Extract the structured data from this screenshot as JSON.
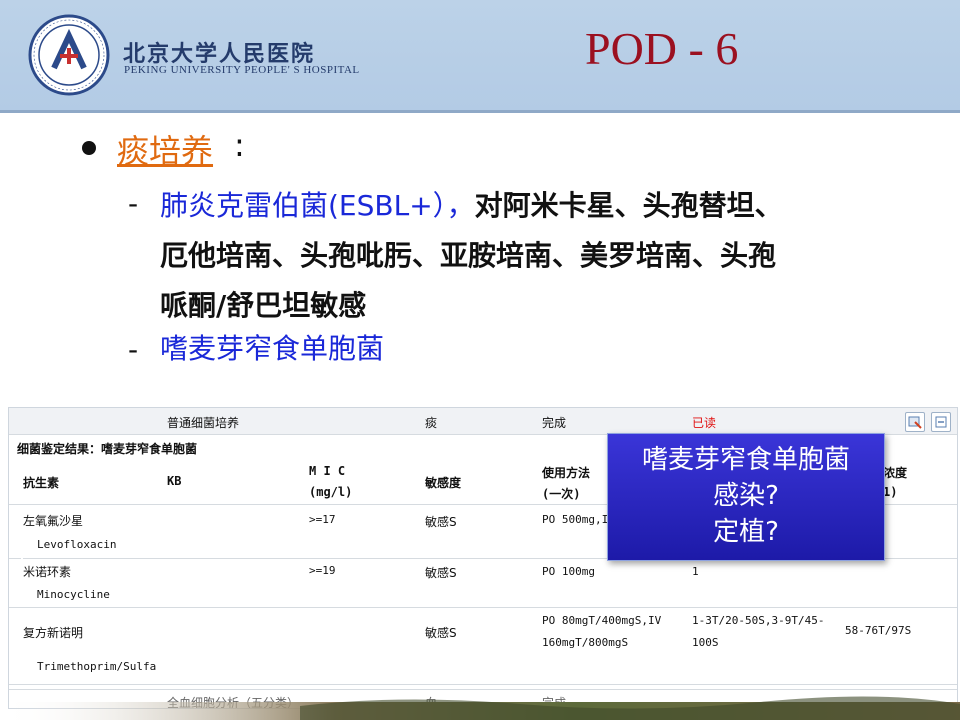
{
  "header": {
    "org_cn": "北京大学人民医院",
    "org_en": "PEKING UNIVERSITY PEOPLE' S HOSPITAL",
    "title": "POD - 6"
  },
  "content": {
    "bullet_title": "痰培养",
    "bullet_colon": ":",
    "item1_blue": "肺炎克雷伯菌(ESBL+），",
    "item1_black_a": "对阿米卡星、头孢替坦、",
    "item1_line2": "厄他培南、头孢吡肟、亚胺培南、美罗培南、头孢",
    "item1_line3": "哌酮/舒巴坦敏感",
    "item2": "嗜麦芽窄食单胞菌",
    "dash": "-"
  },
  "panel": {
    "top_row": [
      "普通细菌培养",
      "痰",
      "完成",
      "已读"
    ],
    "result_title": "细菌鉴定结果：嗜麦芽窄食单胞菌",
    "headers": {
      "antibiotic": "抗生素",
      "kb": "KB",
      "mic_line1": "M I C",
      "mic_line2": "(mg/l)",
      "sensitivity": "敏感度",
      "usage_line1": "使用方法",
      "usage_line2": "(一次)",
      "conc_line1": "浓度",
      "conc_line2": "1)"
    },
    "rows": [
      {
        "name_cn": "左氧氟沙星",
        "name_en": "Levofloxacin",
        "mic": ">=17",
        "sens": "敏感S",
        "usage": "PO 500mg,I",
        "col6": "",
        "col7": ""
      },
      {
        "name_cn": "米诺环素",
        "name_en": "Minocycline",
        "mic": ">=19",
        "sens": "敏感S",
        "usage": "PO 100mg",
        "col6": "1",
        "col7": ""
      },
      {
        "name_cn": "复方新诺明",
        "name_en": "Trimethoprim/Sulfa",
        "mic": "",
        "sens": "敏感S",
        "usage_line1": "PO 80mgT/400mgS,IV",
        "usage_line2": "160mgT/800mgS",
        "col6_line1": "1-3T/20-50S,3-9T/45-",
        "col6_line2": "100S",
        "col7": "58-76T/97S"
      }
    ],
    "bottom_partial": [
      "全血细胞分析（五分类）",
      "血",
      "完成"
    ]
  },
  "callout": {
    "line1": "嗜麦芽窄食单胞菌",
    "line2": "感染?",
    "line3": "定植?"
  }
}
